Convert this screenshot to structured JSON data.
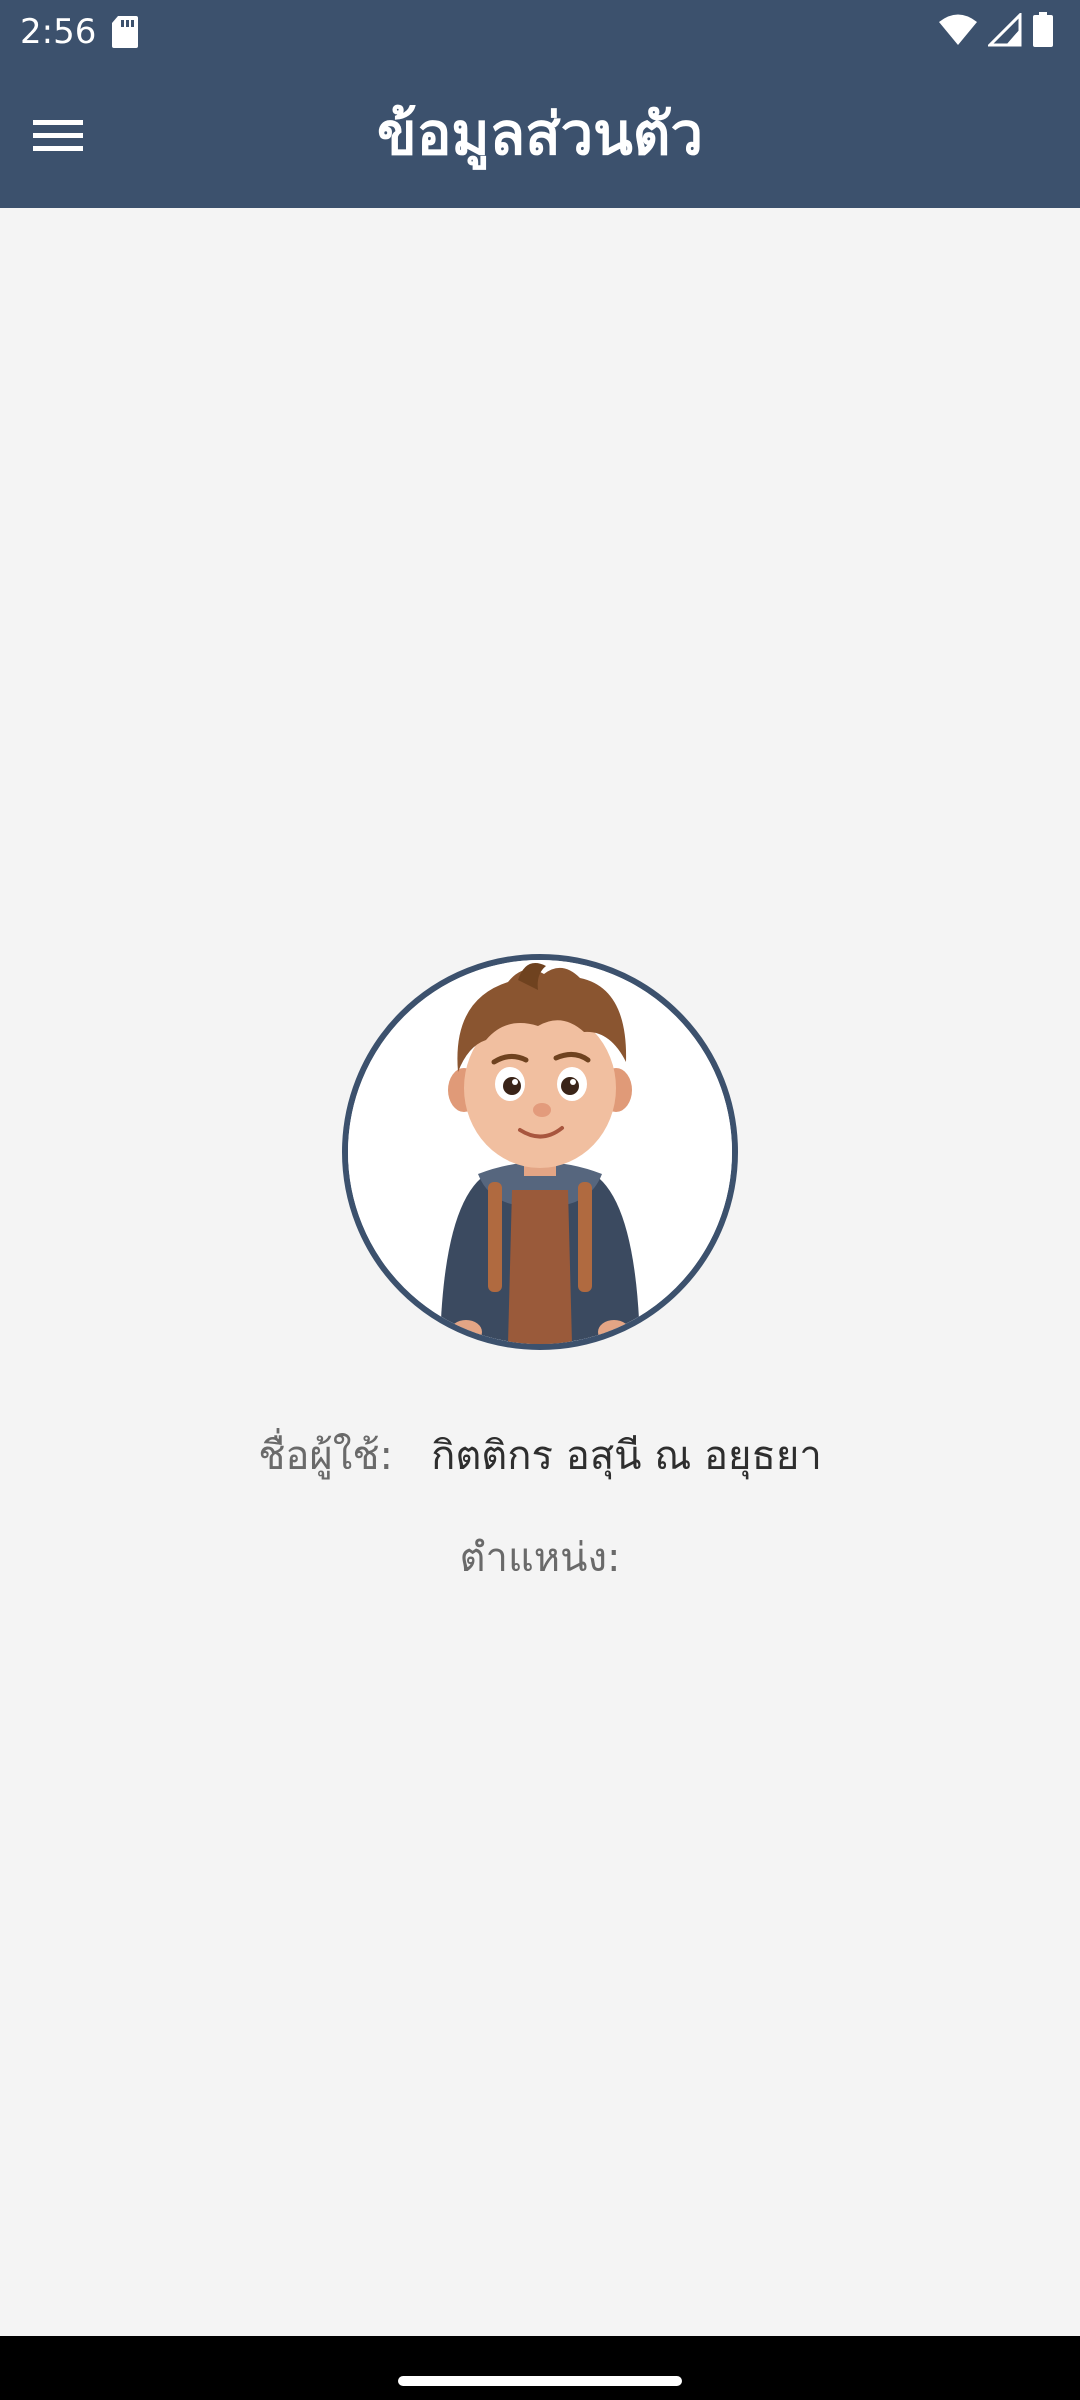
{
  "status_bar": {
    "time": "2:56",
    "icons": [
      "sd-card-icon",
      "wifi-icon",
      "signal-icon",
      "battery-icon"
    ]
  },
  "app_bar": {
    "title": "ข้อมูลส่วนตัว",
    "menu_icon": "menu-icon"
  },
  "profile": {
    "username_label": "ชื่อผู้ใช้:",
    "username_value": "กิตติกร อสุนี ณ อยุธยา",
    "position_label": "ตำแหน่ง:",
    "position_value": ""
  },
  "colors": {
    "primary": "#3c516d",
    "background": "#f4f4f4",
    "label": "#6a6a6a",
    "value": "#2e2e2e"
  }
}
